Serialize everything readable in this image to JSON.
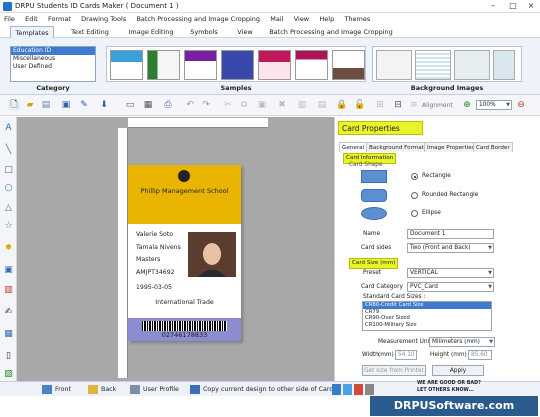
{
  "window": {
    "title": "DRPU Students ID Cards Maker ( Document 1 )"
  },
  "menu": [
    "File",
    "Edit",
    "Format",
    "Drawing Tools",
    "Batch Processing and Image Cropping",
    "Mail",
    "View",
    "Help",
    "Themes"
  ],
  "ribbon_tabs": [
    "Templates",
    "Text Editing",
    "Image Editing",
    "Symbols",
    "View",
    "Batch Processing and Image Cropping"
  ],
  "ribbon": {
    "category_items": [
      "Education ID",
      "Miscellaneous",
      "User Defined"
    ],
    "category_label": "Category",
    "samples_label": "Samples",
    "background_label": "Background Images"
  },
  "toolbar": {
    "alignment_label": "Alignment",
    "zoom_value": "100%"
  },
  "card": {
    "school": "Phillip Management School",
    "name": "Valerie Soto",
    "parent": "Tamala Nivens",
    "course": "Masters",
    "id": "AMJPT34692",
    "date": "1995-03-05",
    "department": "International Trade",
    "barcode_number": "02746178833"
  },
  "panel": {
    "title": "Card Properties",
    "tabs": [
      "General",
      "Background Format",
      "Image Properties",
      "Card Border"
    ],
    "card_information": "Card Information",
    "card_shape": "Card Shape",
    "shape_options": [
      "Rectangle",
      "Rounded Rectangle",
      "Ellipse"
    ],
    "name_label": "Name",
    "name_value": "Document 1",
    "sides_label": "Card sides",
    "sides_value": "Two (Front and Back)",
    "card_size": "Card Size (mm)",
    "preset_label": "Preset",
    "preset_value": "VERTICAL",
    "category_label": "Card Category",
    "category_value": "PVC_Card",
    "standard_label": "Standard Card Sizes :",
    "standard_sizes": [
      "CR80-Credit Card Size",
      "CR79",
      "CR90-Over Sized",
      "CR100-Military Size"
    ],
    "measure_label": "Measurement Unit",
    "measure_value": "Milimeters (mm)",
    "width_label": "Width",
    "width_unit": "(mm)",
    "width_value": "54.10",
    "height_label": "Height",
    "height_unit": "(mm)",
    "height_value": "85.60",
    "get_size_button": "Get size from Printer",
    "apply_button": "Apply"
  },
  "bottom": {
    "front": "Front",
    "back": "Back",
    "user_profile": "User Profile",
    "copy_design": "Copy current design to other side of Card"
  },
  "footer": {
    "wedo_line1": "WE ARE GOOD OR BAD?",
    "wedo_line2": "LET OTHERS KNOW...",
    "brand": "DRPUSoftware.com"
  }
}
